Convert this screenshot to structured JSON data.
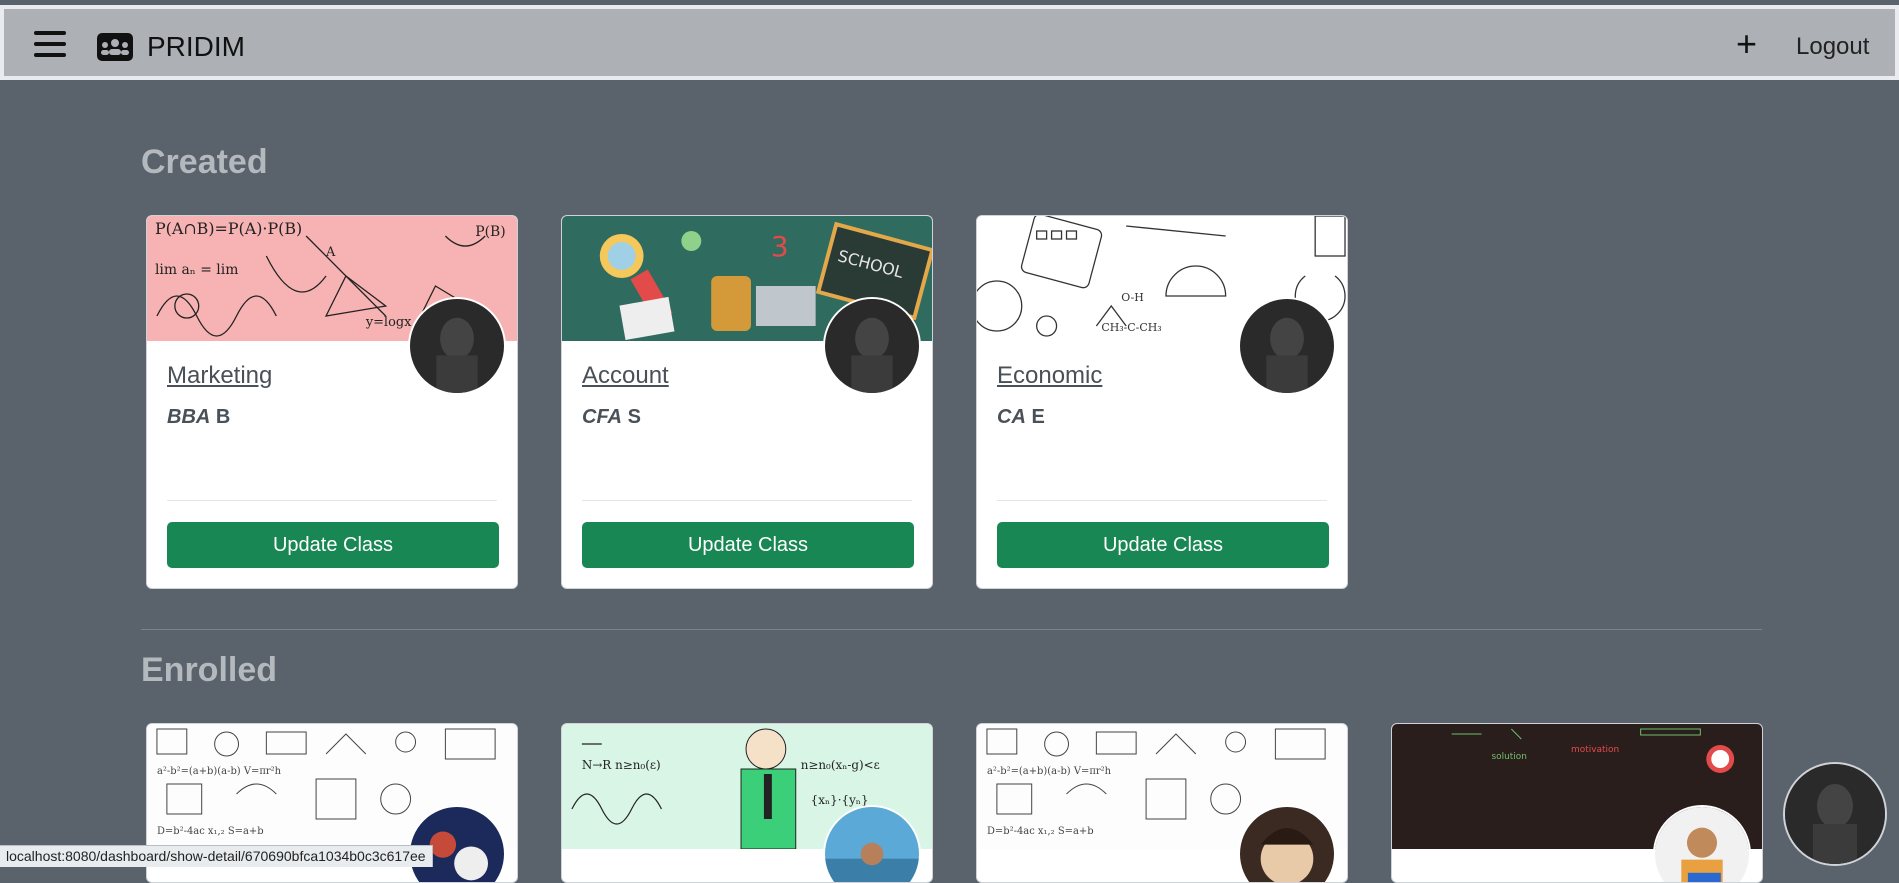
{
  "app": {
    "brand": "PRIDIM",
    "logout_label": "Logout",
    "add_label": "+"
  },
  "sections": {
    "created_title": "Created",
    "enrolled_title": "Enrolled"
  },
  "created": [
    {
      "name": "Marketing",
      "code": "BBA",
      "section": "B",
      "button": "Update Class",
      "theme": "math-pink"
    },
    {
      "name": "Account",
      "code": "CFA",
      "section": "S",
      "button": "Update Class",
      "theme": "school-green"
    },
    {
      "name": "Economic",
      "code": "CA",
      "section": "E",
      "button": "Update Class",
      "theme": "sketch-white"
    }
  ],
  "enrolled": [
    {
      "theme": "formula-white"
    },
    {
      "theme": "teacher-mint"
    },
    {
      "theme": "formula-white"
    },
    {
      "theme": "chalkboard-dark"
    }
  ],
  "status_url": "localhost:8080/dashboard/show-detail/670690bfca1034b0c3c617ee",
  "colors": {
    "accent_green": "#198754",
    "navbar": "#adb1b6",
    "background": "#5a626c"
  }
}
